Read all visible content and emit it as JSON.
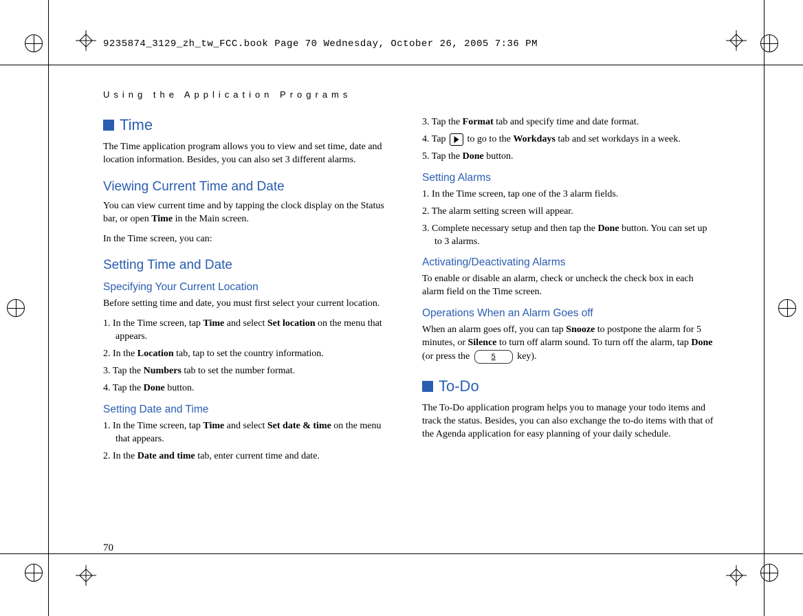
{
  "book_header": "9235874_3129_zh_tw_FCC.book  Page 70  Wednesday, October 26, 2005  7:36 PM",
  "running_head": "Using the Application Programs",
  "page_number": "70",
  "left": {
    "time_heading": "Time",
    "time_intro": "The Time application program allows you to view and set time, date and location information. Besides, you can also set 3 different alarms.",
    "view_heading": "Viewing Current Time and Date",
    "view_p1_a": "You can view current time and by tapping the clock display on the Status bar, or open ",
    "view_p1_b": "Time",
    "view_p1_c": " in the Main screen.",
    "view_p2": "In the Time screen, you can:",
    "set_td_heading": "Setting Time and Date",
    "loc_heading": "Specifying Your Current Location",
    "loc_intro": "Before setting time and date, you must first select your current location.",
    "loc_steps": {
      "s1_a": "1. In the Time screen, tap ",
      "s1_b": "Time",
      "s1_c": " and select ",
      "s1_d": "Set location",
      "s1_e": " on the menu that appears.",
      "s2_a": "2. In the ",
      "s2_b": "Location",
      "s2_c": " tab, tap to set the country information.",
      "s3_a": "3. Tap the ",
      "s3_b": "Numbers",
      "s3_c": " tab to set the number format.",
      "s4_a": "4. Tap the ",
      "s4_b": "Done",
      "s4_c": " button."
    },
    "dt_heading": "Setting Date and Time",
    "dt_steps": {
      "s1_a": "1. In the Time screen, tap ",
      "s1_b": "Time",
      "s1_c": " and select ",
      "s1_d": "Set date & time",
      "s1_e": " on the menu that appears.",
      "s2_a": "2. In the ",
      "s2_b": "Date and time",
      "s2_c": " tab, enter current time and date."
    }
  },
  "right": {
    "cont_steps": {
      "s3_a": "3. Tap the ",
      "s3_b": "Format",
      "s3_c": " tab and specify time and date format.",
      "s4_a": "4. Tap ",
      "s4_b": " to go to the ",
      "s4_c": "Workdays",
      "s4_d": " tab and set workdays in a week.",
      "s5_a": "5. Tap the ",
      "s5_b": "Done",
      "s5_c": " button."
    },
    "alarms_heading": "Setting Alarms",
    "alarms_steps": {
      "s1": "1. In the Time screen, tap one of the 3 alarm fields.",
      "s2": "2. The alarm setting screen will appear.",
      "s3_a": "3. Complete necessary setup and then tap the ",
      "s3_b": "Done",
      "s3_c": " button. You can set up to 3 alarms."
    },
    "activate_heading": "Activating/Deactivating Alarms",
    "activate_p": "To enable or disable an alarm, check or uncheck the check box in each alarm field on the Time screen.",
    "ops_heading": "Operations When an Alarm Goes off",
    "ops_p_a": "When an alarm goes off, you can tap ",
    "ops_p_b": "Snooze",
    "ops_p_c": " to postpone the alarm for 5 minutes, or ",
    "ops_p_d": "Silence",
    "ops_p_e": " to turn off alarm sound. To turn off the alarm, tap ",
    "ops_p_f": "Done",
    "ops_p_g": " (or press the ",
    "ops_key": "5",
    "ops_p_h": " key).",
    "todo_heading": "To-Do",
    "todo_intro": "The To-Do application program helps you to manage your todo items and track the status. Besides, you can also exchange the to-do items with that of the Agenda application for easy planning of your daily schedule."
  }
}
